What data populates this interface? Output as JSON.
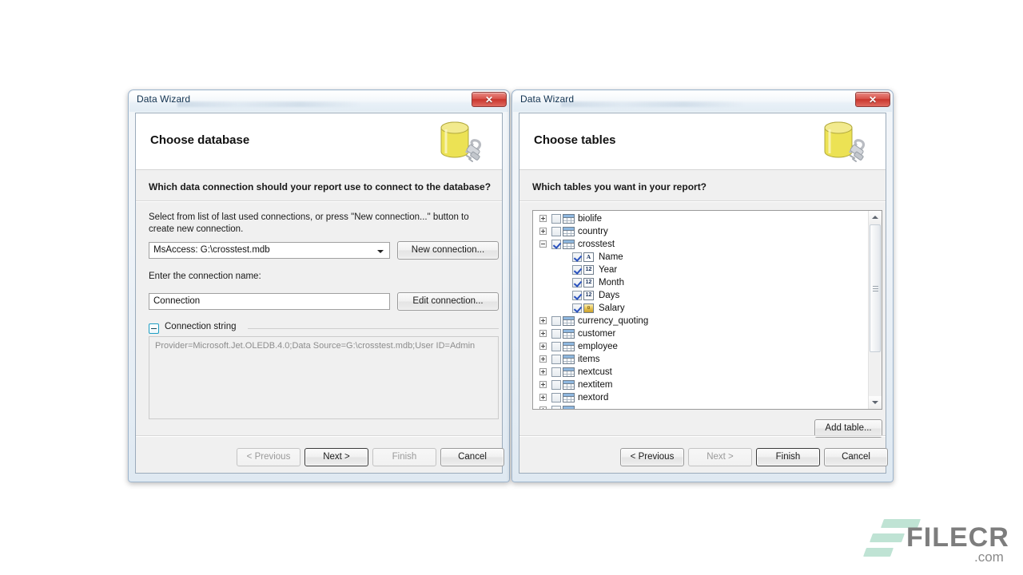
{
  "left_dialog": {
    "title": "Data Wizard",
    "close_label": "✕",
    "heading": "Choose database",
    "db_icon": "database-plug-icon",
    "prompt": "Which data connection should your report use to connect to the database?",
    "description": "Select from list of last used connections, or press \"New connection...\" button to create new connection.",
    "connection_combo_value": "MsAccess: G:\\crosstest.mdb",
    "new_connection_label": "New connection...",
    "connection_name_label": "Enter the connection name:",
    "connection_name_value": "Connection",
    "edit_connection_label": "Edit connection...",
    "group_title": "Connection string",
    "connection_string": "Provider=Microsoft.Jet.OLEDB.4.0;Data Source=G:\\crosstest.mdb;User ID=Admin",
    "buttons": {
      "previous": "< Previous",
      "next": "Next >",
      "finish": "Finish",
      "cancel": "Cancel"
    }
  },
  "right_dialog": {
    "title": "Data Wizard",
    "close_label": "✕",
    "heading": "Choose tables",
    "db_icon": "database-plug-icon",
    "prompt": "Which tables you want in your report?",
    "add_table_label": "Add table...",
    "tree": [
      {
        "label": "biolife",
        "level": 0,
        "expander": "plus",
        "checked": false,
        "icon": "table-icon"
      },
      {
        "label": "country",
        "level": 0,
        "expander": "plus",
        "checked": false,
        "icon": "table-icon"
      },
      {
        "label": "crosstest",
        "level": 0,
        "expander": "minus",
        "checked": true,
        "icon": "table-icon"
      },
      {
        "label": "Name",
        "level": 1,
        "expander": "none",
        "checked": true,
        "icon": "text-field-icon",
        "glyph": "A"
      },
      {
        "label": "Year",
        "level": 1,
        "expander": "none",
        "checked": true,
        "icon": "number-field-icon",
        "glyph": "12"
      },
      {
        "label": "Month",
        "level": 1,
        "expander": "none",
        "checked": true,
        "icon": "number-field-icon",
        "glyph": "12"
      },
      {
        "label": "Days",
        "level": 1,
        "expander": "none",
        "checked": true,
        "icon": "number-field-icon",
        "glyph": "12"
      },
      {
        "label": "Salary",
        "level": 1,
        "expander": "none",
        "checked": true,
        "icon": "currency-field-icon",
        "glyph": "¤"
      },
      {
        "label": "currency_quoting",
        "level": 0,
        "expander": "plus",
        "checked": false,
        "icon": "table-icon"
      },
      {
        "label": "customer",
        "level": 0,
        "expander": "plus",
        "checked": false,
        "icon": "table-icon"
      },
      {
        "label": "employee",
        "level": 0,
        "expander": "plus",
        "checked": false,
        "icon": "table-icon"
      },
      {
        "label": "items",
        "level": 0,
        "expander": "plus",
        "checked": false,
        "icon": "table-icon"
      },
      {
        "label": "nextcust",
        "level": 0,
        "expander": "plus",
        "checked": false,
        "icon": "table-icon"
      },
      {
        "label": "nextitem",
        "level": 0,
        "expander": "plus",
        "checked": false,
        "icon": "table-icon"
      },
      {
        "label": "nextord",
        "level": 0,
        "expander": "plus",
        "checked": false,
        "icon": "table-icon"
      },
      {
        "label": "",
        "level": 0,
        "expander": "plus",
        "checked": false,
        "icon": "table-icon"
      }
    ],
    "buttons": {
      "previous": "< Previous",
      "next": "Next >",
      "finish": "Finish",
      "cancel": "Cancel"
    }
  },
  "watermark": {
    "name": "FILECR",
    "suffix": ".com",
    "logo_color": "#bfe3d4",
    "text_color": "#7d7d7d"
  }
}
